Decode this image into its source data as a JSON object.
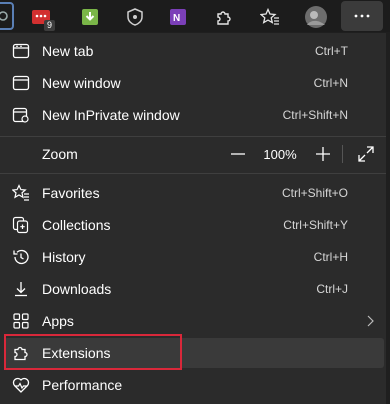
{
  "toolbar": {
    "extensions": [
      {
        "name": "gear-extension-icon"
      },
      {
        "name": "red-calendar-extension-icon",
        "badge": "9"
      },
      {
        "name": "green-download-extension-icon"
      },
      {
        "name": "shield-extension-icon"
      },
      {
        "name": "onenote-extension-icon"
      },
      {
        "name": "extensions-puzzle-icon"
      },
      {
        "name": "favorites-star-icon"
      },
      {
        "name": "profile-avatar"
      }
    ],
    "more_button": "..."
  },
  "menu": {
    "items": [
      {
        "label": "New tab",
        "shortcut": "Ctrl+T",
        "icon": "new-tab-icon"
      },
      {
        "label": "New window",
        "shortcut": "Ctrl+N",
        "icon": "new-window-icon"
      },
      {
        "label": "New InPrivate window",
        "shortcut": "Ctrl+Shift+N",
        "icon": "inprivate-icon"
      },
      {
        "label": "Favorites",
        "shortcut": "Ctrl+Shift+O",
        "icon": "favorites-icon"
      },
      {
        "label": "Collections",
        "shortcut": "Ctrl+Shift+Y",
        "icon": "collections-icon"
      },
      {
        "label": "History",
        "shortcut": "Ctrl+H",
        "icon": "history-icon"
      },
      {
        "label": "Downloads",
        "shortcut": "Ctrl+J",
        "icon": "downloads-icon"
      },
      {
        "label": "Apps",
        "shortcut": "",
        "icon": "apps-icon",
        "submenu": true
      },
      {
        "label": "Extensions",
        "shortcut": "",
        "icon": "extensions-icon",
        "highlighted": true
      },
      {
        "label": "Performance",
        "shortcut": "",
        "icon": "performance-icon"
      }
    ],
    "zoom": {
      "label": "Zoom",
      "value": "100%",
      "minus": "—",
      "plus": "+"
    }
  },
  "colors": {
    "menu_bg": "#2b2b2b",
    "highlight_bg": "#3a3a3a",
    "annotation_red": "#d9283a"
  }
}
